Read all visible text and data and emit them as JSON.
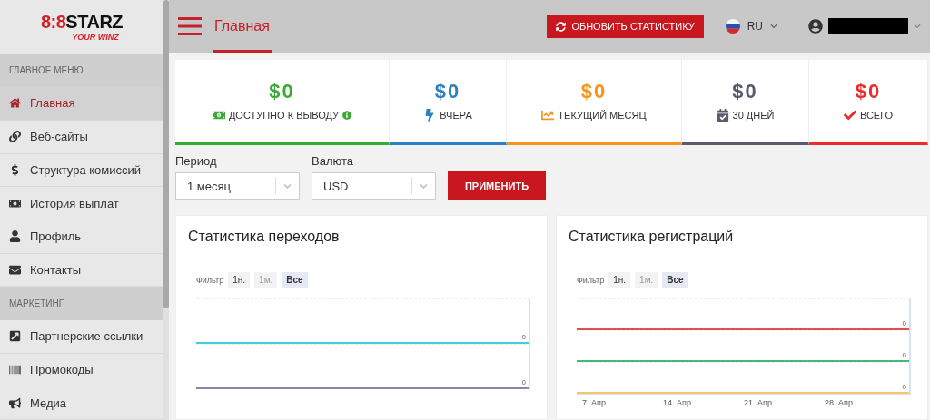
{
  "logo": {
    "mark": "8:8",
    "name": "STARZ",
    "tagline": "YOUR WINZ"
  },
  "sidebar": {
    "sections": [
      {
        "title": "ГЛАВНОЕ МЕНЮ",
        "items": [
          {
            "label": "Главная",
            "selected": true
          },
          {
            "label": "Веб-сайты",
            "selected": false
          },
          {
            "label": "Структура комиссий",
            "selected": false
          },
          {
            "label": "История выплат",
            "selected": false
          },
          {
            "label": "Профиль",
            "selected": false
          },
          {
            "label": "Контакты",
            "selected": false
          }
        ]
      },
      {
        "title": "МАРКЕТИНГ",
        "items": [
          {
            "label": "Партнерские ссылки",
            "selected": false
          },
          {
            "label": "Промокоды",
            "selected": false
          },
          {
            "label": "Медиа",
            "selected": false
          }
        ]
      }
    ]
  },
  "header": {
    "tab": "Главная",
    "refresh_button": "ОБНОВИТЬ СТАТИСТИКУ",
    "language": "RU"
  },
  "stats": [
    {
      "value": "$0",
      "label": "ДОСТУПНО К ВЫВОДУ",
      "color": "#3aaa35",
      "info": true
    },
    {
      "value": "$0",
      "label": "ВЧЕРА",
      "color": "#2f80c0",
      "info": false
    },
    {
      "value": "$0",
      "label": "ТЕКУЩИЙ МЕСЯЦ",
      "color": "#f7941d",
      "info": false
    },
    {
      "value": "$0",
      "label": "30 ДНЕЙ",
      "color": "#5a5a6e",
      "info": false
    },
    {
      "value": "$0",
      "label": "ВСЕГО",
      "color": "#ec2b2b",
      "info": false
    }
  ],
  "filters": {
    "period": {
      "label": "Период",
      "value": "1 месяц"
    },
    "currency": {
      "label": "Валюта",
      "value": "USD"
    },
    "apply_button": "ПРИМЕНИТЬ"
  },
  "charts": [
    {
      "title": "Статистика переходов",
      "filter_label": "Фильтр",
      "filter_options": [
        {
          "label": "1н.",
          "selected": false,
          "disabled": false
        },
        {
          "label": "1м.",
          "selected": false,
          "disabled": true
        },
        {
          "label": "Все",
          "selected": true,
          "disabled": false
        }
      ],
      "strips": [
        {
          "label": "0",
          "color": "#3fd0e0"
        },
        {
          "label": "0",
          "color": "#8a86b0"
        }
      ]
    },
    {
      "title": "Статистика регистраций",
      "filter_label": "Фильтр",
      "filter_options": [
        {
          "label": "1н.",
          "selected": false,
          "disabled": false
        },
        {
          "label": "1м.",
          "selected": false,
          "disabled": true
        },
        {
          "label": "Все",
          "selected": true,
          "disabled": false
        }
      ],
      "strips": [
        {
          "label": "0",
          "color": "#e05050"
        },
        {
          "label": "0",
          "color": "#44b87a"
        },
        {
          "label": "0",
          "color": "#f5c76a"
        }
      ],
      "x_labels": [
        "7. Апр",
        "14. Апр",
        "21. Апр",
        "28. Апр"
      ]
    }
  ]
}
